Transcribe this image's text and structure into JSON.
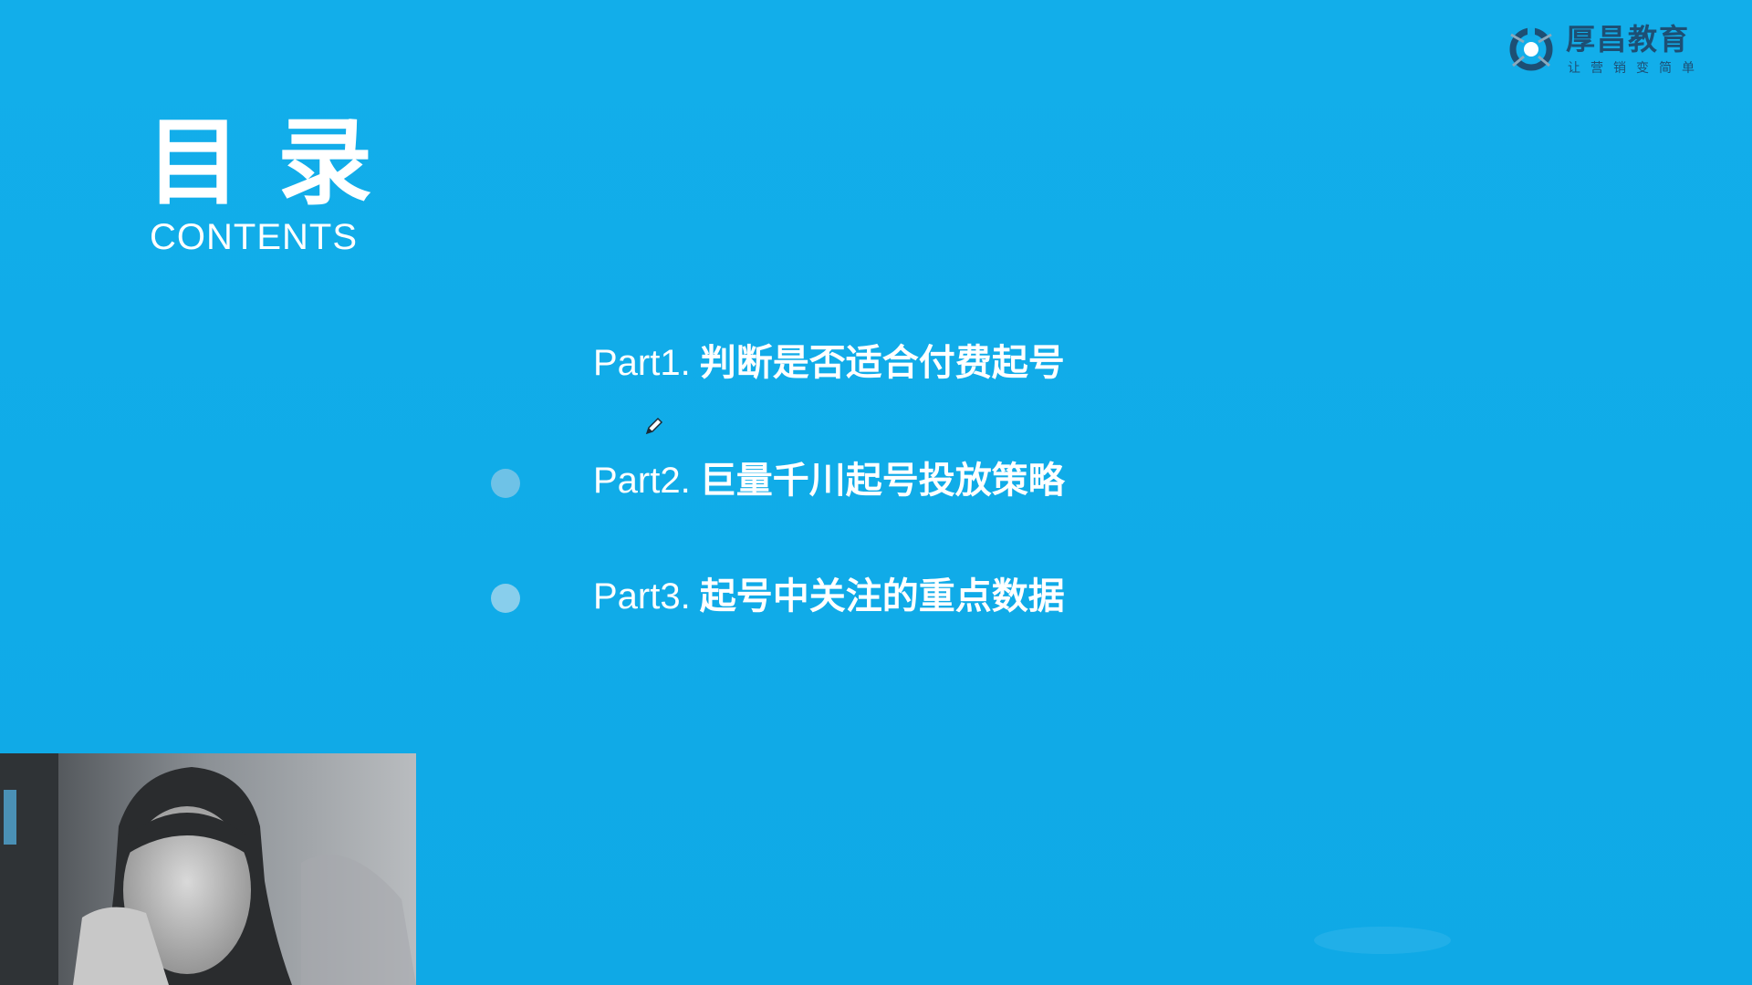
{
  "logo": {
    "title": "厚昌教育",
    "slogan": "让营销变简单"
  },
  "title": {
    "cn": "目录",
    "en": "CONTENTS"
  },
  "items": [
    {
      "part": "Part1.",
      "topic": "判断是否适合付费起号"
    },
    {
      "part": "Part2.",
      "topic": "巨量千川起号投放策略"
    },
    {
      "part": "Part3.",
      "topic": "起号中关注的重点数据"
    }
  ],
  "colors": {
    "background": "#10ace8",
    "text": "#ffffff",
    "logo": "#1d4f74",
    "bullet": "#7fc6e6"
  },
  "icons": {
    "cursor": "pen-cursor-icon",
    "logo": "logo-mark-icon"
  }
}
